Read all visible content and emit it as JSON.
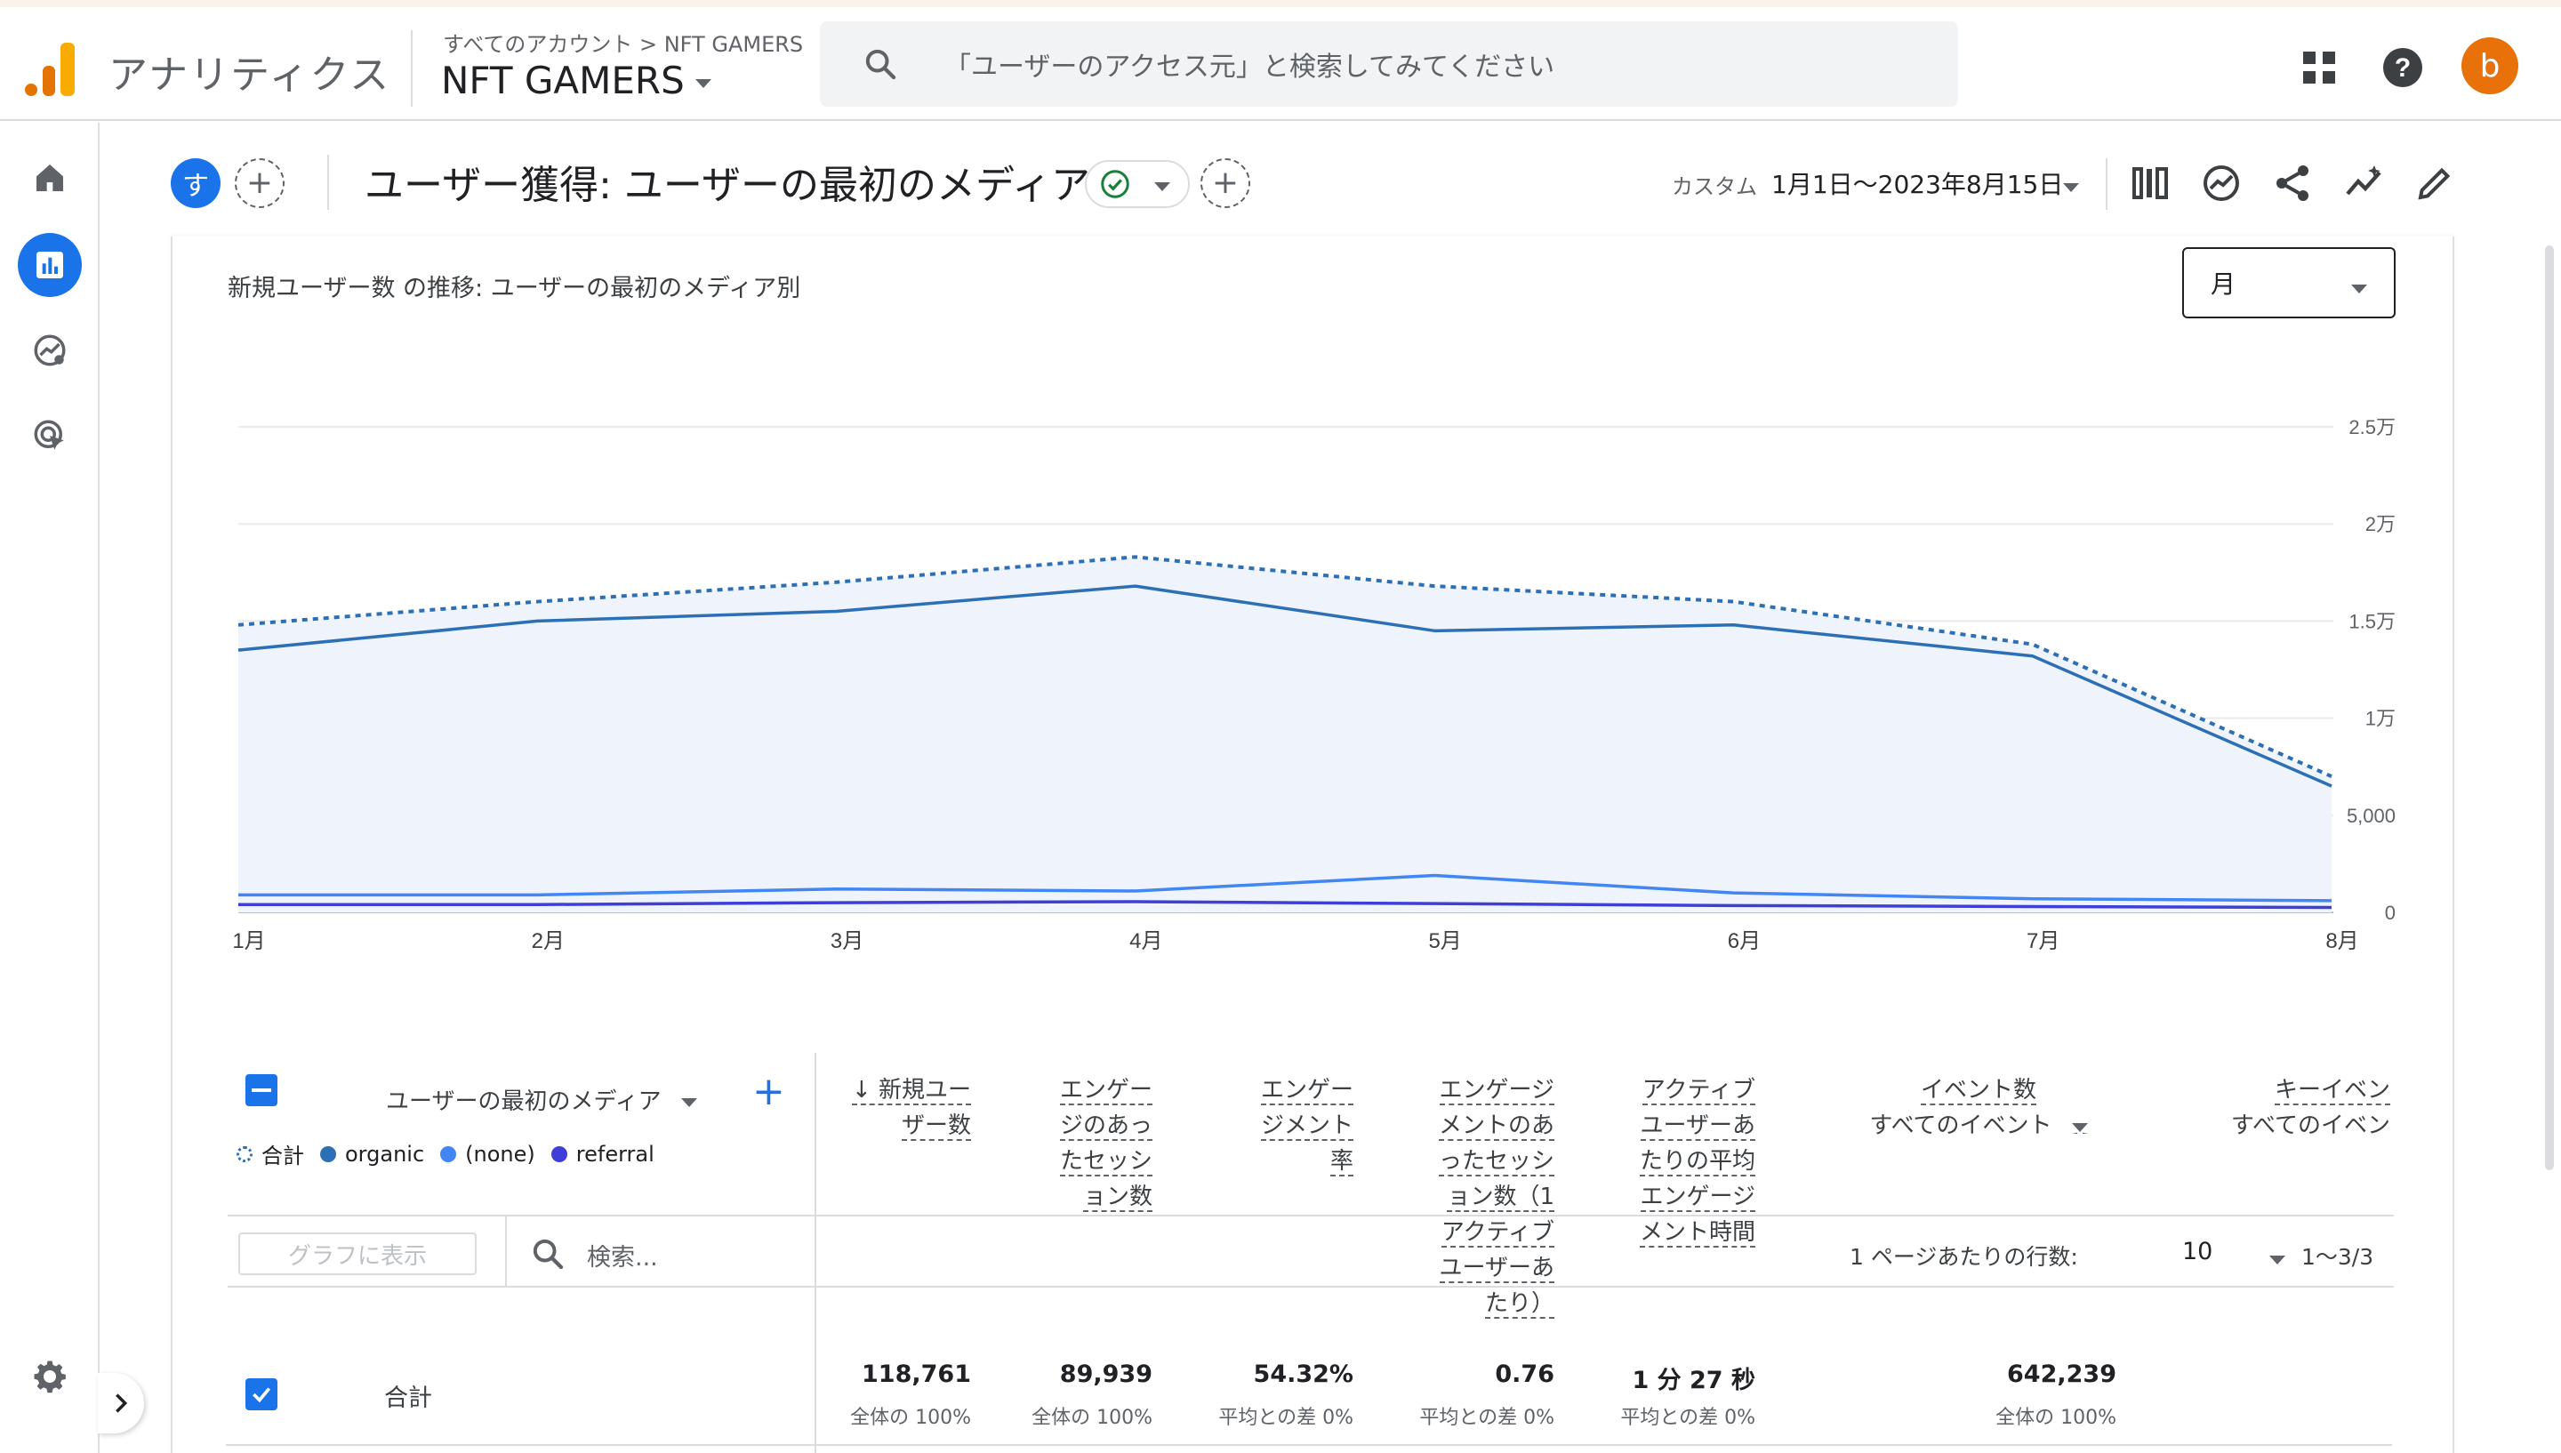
{
  "app": {
    "title": "アナリティクス",
    "breadcrumb": "すべてのアカウント > NFT GAMERS",
    "property": "NFT GAMERS",
    "search_placeholder": "「ユーザーのアクセス元」と検索してみてください",
    "avatar_letter": "b",
    "brand_colors": {
      "logo_dark": "#e37400",
      "logo_light": "#f9ab00",
      "accent": "#1a73e8",
      "avatar": "#e8710a"
    }
  },
  "report": {
    "compare_chip": "す",
    "title": "ユーザー獲得: ユーザーの最初のメディア",
    "date_label": "カスタム",
    "date_range": "1月1日〜2023年8月15日"
  },
  "chart_card": {
    "title": "新規ユーザー数 の推移: ユーザーの最初のメディア別",
    "period": "月"
  },
  "chart_data": {
    "type": "line",
    "categories": [
      "1月",
      "2月",
      "3月",
      "4月",
      "5月",
      "6月",
      "7月",
      "8月"
    ],
    "y_tick_labels": [
      "0",
      "5,000",
      "1万",
      "1.5万",
      "2万",
      "2.5万"
    ],
    "ylim": [
      0,
      25000
    ],
    "grid": true,
    "legend_position": "bottom-left",
    "series": [
      {
        "name": "合計",
        "style": "dotted",
        "color": "#2c6fb5",
        "values": [
          14800,
          16000,
          17000,
          18300,
          16800,
          16000,
          13800,
          7000
        ]
      },
      {
        "name": "organic",
        "style": "solid",
        "color": "#2c6fb5",
        "values": [
          13500,
          15000,
          15500,
          16800,
          14500,
          14800,
          13200,
          6500
        ]
      },
      {
        "name": "(none)",
        "style": "solid",
        "color": "#4285f4",
        "values": [
          900,
          900,
          1200,
          1100,
          1900,
          1000,
          700,
          600
        ]
      },
      {
        "name": "referral",
        "style": "solid",
        "color": "#3f3fd8",
        "values": [
          400,
          400,
          500,
          550,
          450,
          350,
          300,
          250
        ]
      }
    ]
  },
  "table": {
    "plot_button": "グラフに表示",
    "search_placeholder": "検索...",
    "rows_per_page_label": "1 ページあたりの行数:",
    "rows_per_page": "10",
    "pager": "1〜3/3",
    "dimension_header": "ユーザーの最初のメディア",
    "columns": [
      {
        "lines": [
          "↓ 新規ユー",
          "ザー数"
        ]
      },
      {
        "lines": [
          "エンゲー",
          "ジのあっ",
          "たセッシ",
          "ョン数"
        ]
      },
      {
        "lines": [
          "エンゲー",
          "ジメント",
          "率"
        ]
      },
      {
        "lines": [
          "エンゲージ",
          "メントのあ",
          "ったセッシ",
          "ョン数（1",
          "アクティブ",
          "ユーザーあ",
          "たり）"
        ]
      },
      {
        "lines": [
          "アクティブ",
          "ユーザーあ",
          "たりの平均",
          "エンゲージ",
          "メント時間"
        ]
      },
      {
        "lines": [
          "イベント数"
        ],
        "sub": "すべてのイベント"
      },
      {
        "lines": [
          "キーイベン"
        ],
        "sub": "すべてのイベン"
      }
    ],
    "total_row": {
      "label": "合計",
      "values": [
        "118,761",
        "89,939",
        "54.32%",
        "0.76",
        "1 分 27 秒",
        "642,239"
      ],
      "subs": [
        "全体の 100%",
        "全体の 100%",
        "平均との差 0%",
        "平均との差 0%",
        "平均との差 0%",
        "全体の 100%"
      ]
    }
  }
}
